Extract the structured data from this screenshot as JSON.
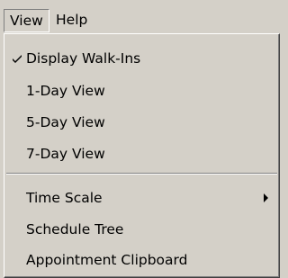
{
  "menubar": {
    "items": [
      {
        "label": "View"
      },
      {
        "label": "Help"
      }
    ]
  },
  "view_menu": {
    "items": [
      {
        "label": "Display Walk-Ins",
        "checked": true
      },
      {
        "label": "1-Day View"
      },
      {
        "label": "5-Day View"
      },
      {
        "label": "7-Day View"
      },
      {
        "label": "Time Scale",
        "submenu": true
      },
      {
        "label": "Schedule Tree"
      },
      {
        "label": "Appointment Clipboard"
      }
    ]
  }
}
